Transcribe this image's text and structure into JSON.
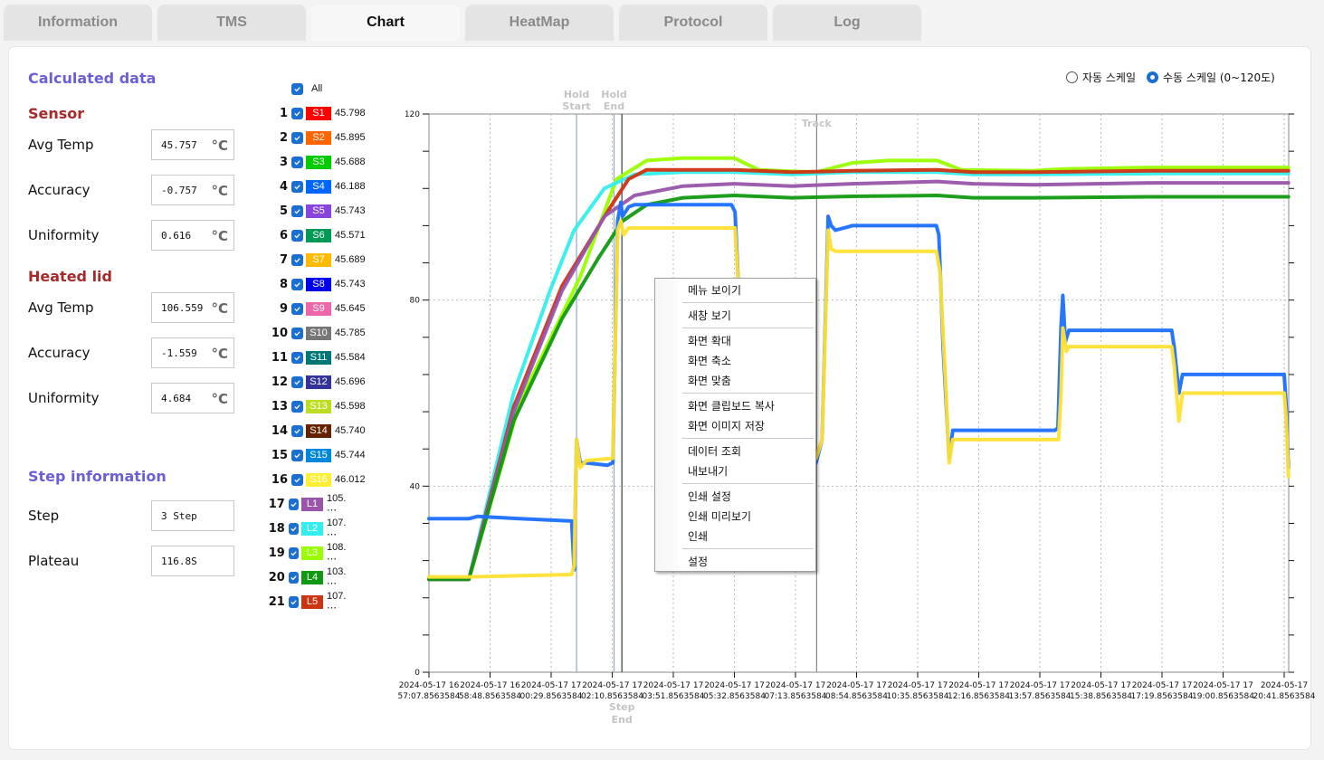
{
  "tabs": [
    {
      "label": "Information",
      "active": false
    },
    {
      "label": "TMS",
      "active": false
    },
    {
      "label": "Chart",
      "active": true
    },
    {
      "label": "HeatMap",
      "active": false
    },
    {
      "label": "Protocol",
      "active": false
    },
    {
      "label": "Log",
      "active": false
    }
  ],
  "left": {
    "title": "Calculated data",
    "sensor": {
      "title": "Sensor",
      "rows": [
        {
          "label": "Avg Temp",
          "value": "45.757",
          "unit": "°C"
        },
        {
          "label": "Accuracy",
          "value": "-0.757",
          "unit": "°C"
        },
        {
          "label": "Uniformity",
          "value": "0.616",
          "unit": "°C"
        }
      ]
    },
    "heated_lid": {
      "title": "Heated lid",
      "rows": [
        {
          "label": "Avg Temp",
          "value": "106.559",
          "unit": "°C"
        },
        {
          "label": "Accuracy",
          "value": "-1.559",
          "unit": "°C"
        },
        {
          "label": "Uniformity",
          "value": "4.684",
          "unit": "°C"
        }
      ]
    },
    "step_info": {
      "title": "Step information",
      "rows": [
        {
          "label": "Step",
          "value": "3 Step"
        },
        {
          "label": "Plateau",
          "value": "116.8S"
        }
      ]
    }
  },
  "legend": {
    "all_label": "All",
    "all_checked": true,
    "items": [
      {
        "num": "1",
        "name": "S1",
        "value": "45.798",
        "color": "#ff0000",
        "checked": true
      },
      {
        "num": "2",
        "name": "S2",
        "value": "45.895",
        "color": "#ff6600",
        "checked": true
      },
      {
        "num": "3",
        "name": "S3",
        "value": "45.688",
        "color": "#00cc00",
        "checked": true
      },
      {
        "num": "4",
        "name": "S4",
        "value": "46.188",
        "color": "#0066ff",
        "checked": true
      },
      {
        "num": "5",
        "name": "S5",
        "value": "45.743",
        "color": "#8844dd",
        "checked": true
      },
      {
        "num": "6",
        "name": "S6",
        "value": "45.571",
        "color": "#009955",
        "checked": true
      },
      {
        "num": "7",
        "name": "S7",
        "value": "45.689",
        "color": "#ffbb00",
        "checked": true
      },
      {
        "num": "8",
        "name": "S8",
        "value": "45.743",
        "color": "#0000ee",
        "checked": true
      },
      {
        "num": "9",
        "name": "S9",
        "value": "45.645",
        "color": "#ee66aa",
        "checked": true
      },
      {
        "num": "10",
        "name": "S10",
        "value": "45.785",
        "color": "#777777",
        "checked": true
      },
      {
        "num": "11",
        "name": "S11",
        "value": "45.584",
        "color": "#007777",
        "checked": true
      },
      {
        "num": "12",
        "name": "S12",
        "value": "45.696",
        "color": "#333399",
        "checked": true
      },
      {
        "num": "13",
        "name": "S13",
        "value": "45.598",
        "color": "#bbdd22",
        "checked": true
      },
      {
        "num": "14",
        "name": "S14",
        "value": "45.740",
        "color": "#662200",
        "checked": true
      },
      {
        "num": "15",
        "name": "S15",
        "value": "45.744",
        "color": "#0088dd",
        "checked": true
      },
      {
        "num": "16",
        "name": "S16",
        "value": "46.012",
        "color": "#ffee33",
        "checked": true
      },
      {
        "num": "17",
        "name": "L1",
        "value": "105. ⋯",
        "color": "#9955aa",
        "checked": true
      },
      {
        "num": "18",
        "name": "L2",
        "value": "107. ⋯",
        "color": "#33eeee",
        "checked": true
      },
      {
        "num": "19",
        "name": "L3",
        "value": "108. ⋯",
        "color": "#99ff00",
        "checked": true
      },
      {
        "num": "20",
        "name": "L4",
        "value": "103. ⋯",
        "color": "#119911",
        "checked": true
      },
      {
        "num": "21",
        "name": "L5",
        "value": "107. ⋯",
        "color": "#cc3311",
        "checked": true
      }
    ]
  },
  "scale": {
    "auto_label": "자동 스케일",
    "manual_label": "수동 스케일 (0~120도)",
    "selected": "manual"
  },
  "context_menu": {
    "groups": [
      [
        "메뉴 보이기"
      ],
      [
        "새창 보기"
      ],
      [
        "화면 확대",
        "화면 축소",
        "화면 맞춤"
      ],
      [
        "화면 클립보드 복사",
        "화면 이미지 저장"
      ],
      [
        "데이터 조회",
        "내보내기"
      ],
      [
        "인쇄 설정",
        "인쇄 미리보기",
        "인쇄"
      ],
      [
        "설정"
      ]
    ]
  },
  "chart_data": {
    "type": "line",
    "title": "",
    "xlabel": "",
    "ylabel": "",
    "ylim": [
      0,
      120
    ],
    "yticks": [
      0,
      40,
      80,
      120
    ],
    "y_minor_step": 8,
    "x_unit": "seconds since 2024-05-17 16:57:07.8563584",
    "xlim": [
      0,
      1421
    ],
    "xticks": [
      {
        "t": 0,
        "label": [
          "2024-05-17 16",
          "57:07.8563584"
        ]
      },
      {
        "t": 101,
        "label": [
          "2024-05-17 16",
          "58:48.8563584"
        ]
      },
      {
        "t": 202,
        "label": [
          "2024-05-17 17",
          "00:29.8563584"
        ]
      },
      {
        "t": 303,
        "label": [
          "2024-05-17 17",
          "02:10.8563584"
        ]
      },
      {
        "t": 404,
        "label": [
          "2024-05-17 17",
          "03:51.8563584"
        ]
      },
      {
        "t": 505,
        "label": [
          "2024-05-17 17",
          "05:32.8563584"
        ]
      },
      {
        "t": 606,
        "label": [
          "2024-05-17 17",
          "07:13.8563584"
        ]
      },
      {
        "t": 707,
        "label": [
          "2024-05-17 17",
          "08:54.8563584"
        ]
      },
      {
        "t": 808,
        "label": [
          "2024-05-17 17",
          "10:35.8563584"
        ]
      },
      {
        "t": 909,
        "label": [
          "2024-05-17 17",
          "12:16.8563584"
        ]
      },
      {
        "t": 1010,
        "label": [
          "2024-05-17 17",
          "13:57.8563584"
        ]
      },
      {
        "t": 1111,
        "label": [
          "2024-05-17 17",
          "15:38.8563584"
        ]
      },
      {
        "t": 1212,
        "label": [
          "2024-05-17 17",
          "17:19.8563584"
        ]
      },
      {
        "t": 1313,
        "label": [
          "2024-05-17 17",
          "19:00.8563584"
        ]
      },
      {
        "t": 1414,
        "label": [
          "2024-05-17",
          "20:41.8563584"
        ]
      }
    ],
    "markers": [
      {
        "t": 244,
        "label": [
          "Hold",
          "Start"
        ],
        "position": "top",
        "color": "#8fa8c8"
      },
      {
        "t": 306,
        "label": [
          "Hold",
          "End"
        ],
        "position": "top",
        "color": "#8fa8c8"
      },
      {
        "t": 319,
        "label": [
          "Step",
          "End"
        ],
        "position": "bottom",
        "color": "#334444"
      },
      {
        "t": 641,
        "label": [
          "Track"
        ],
        "position": "inside-top",
        "color": "#888888"
      }
    ],
    "series": [
      {
        "name": "L3",
        "color": "#99ff00",
        "points": [
          [
            0,
            20
          ],
          [
            66,
            20
          ],
          [
            150,
            58
          ],
          [
            250,
            85
          ],
          [
            310,
            106
          ],
          [
            360,
            110
          ],
          [
            420,
            110.5
          ],
          [
            505,
            110.5
          ],
          [
            545,
            108
          ],
          [
            640,
            107.5
          ],
          [
            700,
            109.5
          ],
          [
            760,
            110
          ],
          [
            840,
            110
          ],
          [
            880,
            108
          ],
          [
            1000,
            107.8
          ],
          [
            1050,
            108.2
          ],
          [
            1200,
            108.5
          ],
          [
            1421,
            108.5
          ]
        ]
      },
      {
        "name": "L2",
        "color": "#33eeee",
        "points": [
          [
            0,
            20
          ],
          [
            66,
            20
          ],
          [
            140,
            60
          ],
          [
            200,
            82
          ],
          [
            240,
            95
          ],
          [
            290,
            104
          ],
          [
            340,
            107
          ],
          [
            420,
            107.5
          ],
          [
            505,
            107.5
          ],
          [
            600,
            107
          ],
          [
            700,
            107.5
          ],
          [
            840,
            107.5
          ],
          [
            900,
            107
          ],
          [
            1000,
            107
          ],
          [
            1200,
            107.2
          ],
          [
            1421,
            107.2
          ]
        ]
      },
      {
        "name": "L5",
        "color": "#cc3311",
        "points": [
          [
            0,
            20
          ],
          [
            66,
            20
          ],
          [
            140,
            57
          ],
          [
            220,
            83
          ],
          [
            300,
            100
          ],
          [
            330,
            106
          ],
          [
            360,
            108
          ],
          [
            420,
            108
          ],
          [
            505,
            108
          ],
          [
            600,
            107.5
          ],
          [
            700,
            107.8
          ],
          [
            840,
            108
          ],
          [
            900,
            107.5
          ],
          [
            1000,
            107.5
          ],
          [
            1200,
            107.8
          ],
          [
            1421,
            107.8
          ]
        ]
      },
      {
        "name": "L1",
        "color": "#9955aa",
        "points": [
          [
            0,
            20
          ],
          [
            66,
            20
          ],
          [
            140,
            56
          ],
          [
            220,
            82
          ],
          [
            290,
            98
          ],
          [
            340,
            102.5
          ],
          [
            420,
            104.5
          ],
          [
            505,
            105
          ],
          [
            600,
            104.5
          ],
          [
            700,
            105
          ],
          [
            840,
            105.5
          ],
          [
            900,
            105
          ],
          [
            1000,
            104.8
          ],
          [
            1200,
            105.2
          ],
          [
            1421,
            105.2
          ]
        ]
      },
      {
        "name": "L4",
        "color": "#119911",
        "points": [
          [
            0,
            20
          ],
          [
            66,
            20
          ],
          [
            140,
            54
          ],
          [
            220,
            76
          ],
          [
            280,
            89
          ],
          [
            320,
            97
          ],
          [
            360,
            100.5
          ],
          [
            420,
            102
          ],
          [
            505,
            102.5
          ],
          [
            600,
            102
          ],
          [
            700,
            102.3
          ],
          [
            840,
            102.5
          ],
          [
            900,
            102
          ],
          [
            1000,
            102
          ],
          [
            1200,
            102.2
          ],
          [
            1421,
            102.2
          ]
        ]
      },
      {
        "name": "S4",
        "color": "#1a6fff",
        "points": [
          [
            0,
            33
          ],
          [
            66,
            33
          ],
          [
            80,
            33.5
          ],
          [
            150,
            33
          ],
          [
            236,
            32.5
          ],
          [
            240,
            22
          ],
          [
            244,
            50
          ],
          [
            250,
            45
          ],
          [
            260,
            45
          ],
          [
            295,
            44.5
          ],
          [
            304,
            45
          ],
          [
            312,
            97
          ],
          [
            317,
            101
          ],
          [
            320,
            98
          ],
          [
            330,
            100
          ],
          [
            340,
            100.5
          ],
          [
            500,
            100.5
          ],
          [
            506,
            99
          ],
          [
            512,
            82
          ],
          [
            520,
            60
          ],
          [
            560,
            46
          ],
          [
            640,
            45
          ],
          [
            650,
            50
          ],
          [
            660,
            98
          ],
          [
            665,
            96
          ],
          [
            672,
            95
          ],
          [
            700,
            96
          ],
          [
            839,
            96
          ],
          [
            843,
            94
          ],
          [
            850,
            70
          ],
          [
            860,
            46
          ],
          [
            866,
            52
          ],
          [
            1035,
            52
          ],
          [
            1040,
            52.5
          ],
          [
            1045,
            74
          ],
          [
            1048,
            81
          ],
          [
            1052,
            71
          ],
          [
            1058,
            73.5
          ],
          [
            1228,
            73.5
          ],
          [
            1232,
            70
          ],
          [
            1240,
            60
          ],
          [
            1246,
            64
          ],
          [
            1414,
            64
          ],
          [
            1417,
            58
          ],
          [
            1421,
            44
          ]
        ]
      },
      {
        "name": "S16",
        "color": "#ffe033",
        "points": [
          [
            0,
            20.5
          ],
          [
            66,
            20.5
          ],
          [
            236,
            21
          ],
          [
            240,
            23
          ],
          [
            244,
            50
          ],
          [
            250,
            44
          ],
          [
            260,
            45.5
          ],
          [
            304,
            46
          ],
          [
            312,
            95
          ],
          [
            317,
            97
          ],
          [
            322,
            94
          ],
          [
            330,
            95.5
          ],
          [
            506,
            95.5
          ],
          [
            512,
            82
          ],
          [
            520,
            60
          ],
          [
            560,
            46
          ],
          [
            640,
            46
          ],
          [
            650,
            50
          ],
          [
            660,
            95
          ],
          [
            665,
            91
          ],
          [
            672,
            90.5
          ],
          [
            839,
            90.5
          ],
          [
            845,
            86
          ],
          [
            855,
            60
          ],
          [
            860,
            45
          ],
          [
            866,
            50
          ],
          [
            1041,
            50
          ],
          [
            1045,
            60
          ],
          [
            1048,
            74
          ],
          [
            1054,
            69
          ],
          [
            1058,
            70
          ],
          [
            1228,
            70
          ],
          [
            1232,
            66
          ],
          [
            1240,
            54
          ],
          [
            1246,
            60
          ],
          [
            1414,
            60
          ],
          [
            1417,
            55
          ],
          [
            1421,
            42
          ]
        ]
      }
    ]
  }
}
